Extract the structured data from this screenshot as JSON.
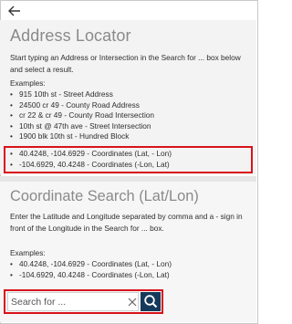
{
  "address_locator": {
    "title": "Address Locator",
    "intro": "Start typing an Address or Intersection in the Search for ... box below and select a result.",
    "examples_label": "Examples:",
    "examples": [
      "915 10th st - Street Address",
      "24500 cr 49 - County Road Address",
      "cr 22 & cr 49 - County Road Intersection",
      "10th st @ 47th ave - Street Intersection",
      "1900 blk 10th st - Hundred Block"
    ],
    "coordinate_examples": [
      "40.4248, -104.6929 - Coordinates (Lat, - Lon)",
      "-104.6929, 40.4248 - Coordinates (-Lon, Lat)"
    ]
  },
  "coordinate_search": {
    "title": "Coordinate Search (Lat/Lon)",
    "intro": "Enter the Latitude and Longitude separated by comma and a - sign in front of the Longitude in the Search for ... box.",
    "examples_label": "Examples:",
    "examples": [
      "40.4248, -104.6929 - Coordinates (Lat, - Lon)",
      "-104.6929, 40.4248 - Coordinates (-Lon, Lat)"
    ]
  },
  "search": {
    "placeholder": "Search for ...",
    "value": ""
  },
  "icons": {
    "back": "arrow-left-icon",
    "clear": "close-icon",
    "search": "search-icon"
  },
  "colors": {
    "highlight": "#d9121b",
    "search_button": "#15395a",
    "heading": "#8a8a8a"
  }
}
